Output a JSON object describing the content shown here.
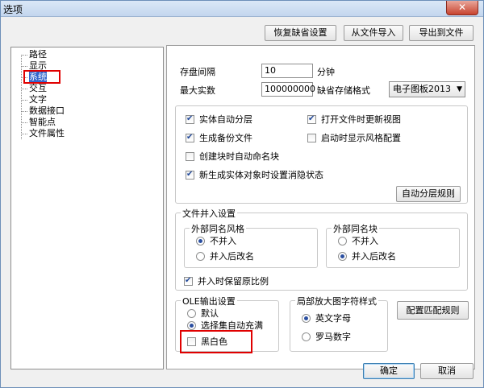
{
  "window": {
    "title": "选项",
    "close_symbol": "✕"
  },
  "toolbar": {
    "restore_defaults": "恢复缺省设置",
    "import_file": "从文件导入",
    "export_file": "导出到文件"
  },
  "tree": {
    "items": [
      {
        "label": "路径",
        "selected": false
      },
      {
        "label": "显示",
        "selected": false
      },
      {
        "label": "系统",
        "selected": true
      },
      {
        "label": "交互",
        "selected": false
      },
      {
        "label": "文字",
        "selected": false
      },
      {
        "label": "数据接口",
        "selected": false
      },
      {
        "label": "智能点",
        "selected": false
      },
      {
        "label": "文件属性",
        "selected": false
      }
    ]
  },
  "system": {
    "autosave_label": "存盘间隔",
    "autosave_value": "10",
    "autosave_unit": "分钟",
    "max_entities_label": "最大实数",
    "max_entities_value": "100000000",
    "default_format_label": "缺省存储格式",
    "default_format_value": "电子图板2013",
    "checkboxes": {
      "auto_layer": {
        "label": "实体自动分层",
        "checked": true
      },
      "update_view": {
        "label": "打开文件时更新视图",
        "checked": true
      },
      "backup": {
        "label": "生成备份文件",
        "checked": true
      },
      "show_style": {
        "label": "启动时显示风格配置",
        "checked": false
      },
      "auto_block_name": {
        "label": "创建块时自动命名块",
        "checked": false
      },
      "hidden_state": {
        "label": "新生成实体对象时设置消隐状态",
        "checked": true
      }
    },
    "auto_layer_rules": "自动分层规则"
  },
  "merge": {
    "title": "文件并入设置",
    "ext_style": {
      "title": "外部同名风格",
      "options": [
        "不并入",
        "并入后改名"
      ],
      "selected": 0
    },
    "ext_block": {
      "title": "外部同名块",
      "options": [
        "不并入",
        "并入后改名"
      ],
      "selected": 1
    },
    "keep_scale": {
      "label": "并入时保留原比例",
      "checked": true
    }
  },
  "ole": {
    "title": "OLE输出设置",
    "options": [
      "默认",
      "选择集自动充满"
    ],
    "selected": 1,
    "bw": {
      "label": "黑白色",
      "checked": false
    }
  },
  "zoom_symbol": {
    "title": "局部放大图字符样式",
    "options": [
      "英文字母",
      "罗马数字"
    ],
    "selected": 0,
    "config_rules": "配置匹配规则"
  },
  "footer": {
    "ok": "确定",
    "cancel": "取消"
  }
}
